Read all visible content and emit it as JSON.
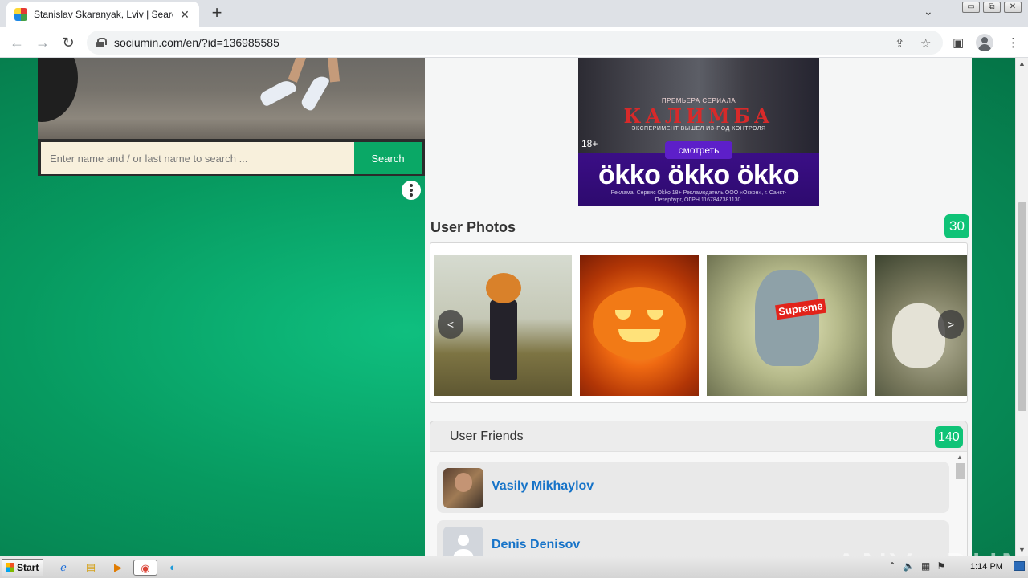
{
  "browser": {
    "tab_title": "Stanislav Skaranyak, Lviv | Search In",
    "tab_close": "✕",
    "new_tab": "+",
    "url": "sociumin.com/en/?id=136985585"
  },
  "window_controls": {
    "minimize": "▭",
    "restore": "⧉",
    "close": "✕"
  },
  "search": {
    "placeholder": "Enter name and / or last name to search ...",
    "button_label": "Search"
  },
  "ad": {
    "pre_title": "ПРЕМЬЕРА СЕРИАЛА",
    "title": "КАЛИМБА",
    "subtitle": "ЭКСПЕРИМЕНТ ВЫШЕЛ ИЗ-ПОД КОНТРОЛЯ",
    "age": "18+",
    "cta": "смотреть",
    "logos": "ökko ökko ökko",
    "legal": "Реклама. Сервис Okko 18+ Рекламодатель ООО «Оккон», г. Санкт-Петербург, ОГРН 1167847381130."
  },
  "photos": {
    "title": "User Photos",
    "count": "30",
    "prev": "<",
    "next": ">",
    "items": [
      {
        "label": ""
      },
      {
        "label": ""
      },
      {
        "label": "Supreme"
      },
      {
        "label": ""
      }
    ]
  },
  "friends": {
    "title": "User Friends",
    "count": "140",
    "items": [
      {
        "name": "Vasily Mikhaylov"
      },
      {
        "name": "Denis Denisov"
      }
    ]
  },
  "watermark": "ANY▷RUN",
  "taskbar": {
    "start_label": "Start",
    "clock": "1:14 PM"
  }
}
